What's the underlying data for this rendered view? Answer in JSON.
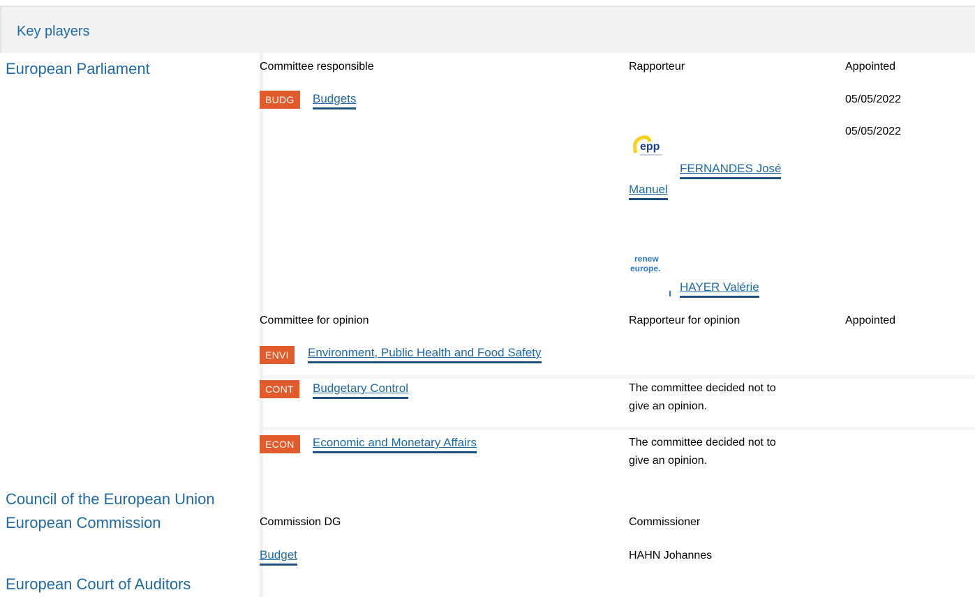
{
  "header": {
    "title": "Key players"
  },
  "institutions": {
    "parliament": "European Parliament",
    "council": "Council of the European Union",
    "commission": "European Commission",
    "auditors": "European Court of Auditors"
  },
  "parliament": {
    "committee_responsible_label": "Committee responsible",
    "rapporteur_label": "Rapporteur",
    "appointed_label": "Appointed",
    "committee_responsible": {
      "code": "BUDG",
      "name": "Budgets"
    },
    "dates": [
      "05/05/2022",
      "05/05/2022"
    ],
    "rapporteurs": [
      {
        "group_logo": "epp-logo",
        "name_line1": "FERNANDES José",
        "name_line2": "Manuel"
      },
      {
        "group_logo": "renew-europe-logo",
        "name": "HAYER Valérie"
      }
    ],
    "committee_opinion_label": "Committee for opinion",
    "rapporteur_opinion_label": "Rapporteur for opinion",
    "appointed_opinion_label": "Appointed",
    "opinion_committees": [
      {
        "code": "ENVI",
        "name": "Environment, Public Health and Food Safety",
        "note": ""
      },
      {
        "code": "CONT",
        "name": "Budgetary Control",
        "note_line1": "The committee decided not to",
        "note_line2": "give an opinion."
      },
      {
        "code": "ECON",
        "name": "Economic and Monetary Affairs",
        "note_line1": "The committee decided not to",
        "note_line2": "give an opinion."
      }
    ]
  },
  "commission": {
    "dg_label": "Commission DG",
    "commissioner_label": "Commissioner",
    "dg": "Budget",
    "commissioner": "HAHN Johannes"
  },
  "colors": {
    "accent": "#1f6aa6",
    "badge": "#e25b2c",
    "underline": "#1f4f7f"
  }
}
